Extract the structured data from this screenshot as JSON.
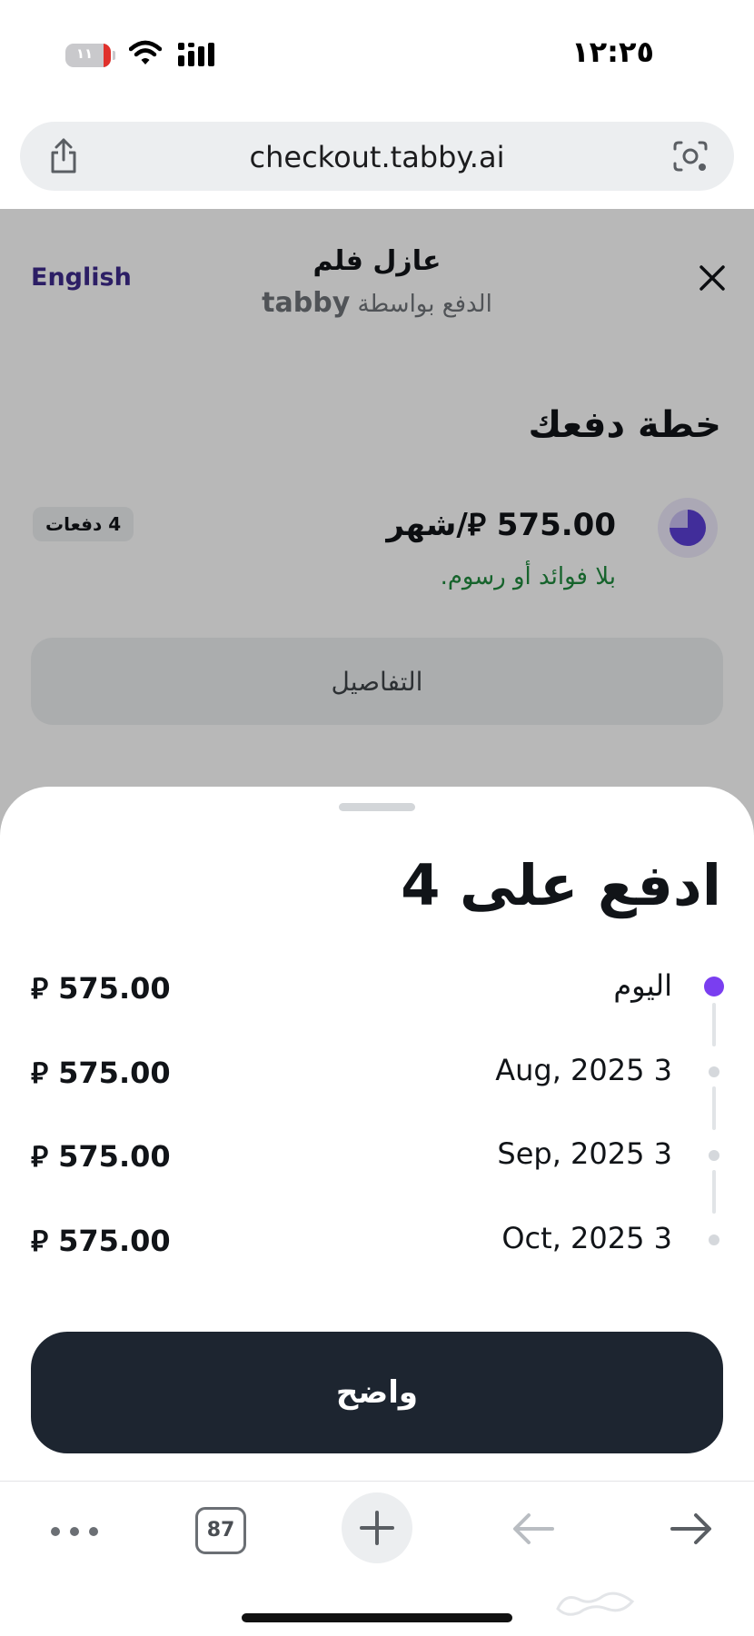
{
  "status_bar": {
    "time": "١٢:٢٥",
    "battery_level": "١١"
  },
  "browser": {
    "url": "checkout.tabby.ai",
    "tab_count": "87"
  },
  "header": {
    "language_link": "English",
    "merchant_name": "عازل فلم",
    "powered_by": "الدفع بواسطة",
    "brand": "tabby"
  },
  "plan": {
    "title": "خطة دفعك",
    "amount_per_month": "575.00 ⃁/شهر",
    "note": "بلا فوائد أو رسوم.",
    "installments_badge": "4 دفعات",
    "details_button": "التفاصيل"
  },
  "sheet": {
    "title": "ادفع على 4",
    "schedule": [
      {
        "date": "اليوم",
        "amount": "⃁ 575.00",
        "current": true
      },
      {
        "date": "3 Aug, 2025",
        "amount": "⃁ 575.00",
        "current": false
      },
      {
        "date": "3 Sep, 2025",
        "amount": "⃁ 575.00",
        "current": false
      },
      {
        "date": "3 Oct, 2025",
        "amount": "⃁ 575.00",
        "current": false
      }
    ],
    "confirm_button": "واضح"
  },
  "colors": {
    "accent_purple": "#7a3ef0",
    "dark_button": "#1d2530",
    "success_green": "#1f8a3d",
    "link_purple": "#3d2a8c"
  },
  "icons": {
    "share": "share-icon",
    "lens": "lens-icon",
    "close": "close-icon",
    "more": "more-icon",
    "new_tab": "plus-icon",
    "back": "arrow-left-icon",
    "forward": "arrow-right-icon"
  }
}
